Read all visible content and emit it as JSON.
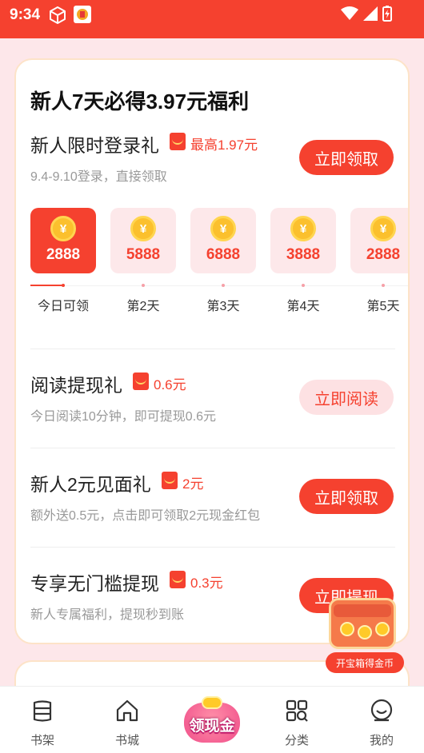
{
  "status_bar": {
    "time": "9:34"
  },
  "card": {
    "title": "新人7天必得3.97元福利",
    "login": {
      "title": "新人限时登录礼",
      "reward": "最高1.97元",
      "sub": "9.4-9.10登录，直接领取",
      "button": "立即领取"
    },
    "days": [
      {
        "amount": "2888",
        "label": "今日可领",
        "active": true
      },
      {
        "amount": "5888",
        "label": "第2天",
        "active": false
      },
      {
        "amount": "6888",
        "label": "第3天",
        "active": false
      },
      {
        "amount": "3888",
        "label": "第4天",
        "active": false
      },
      {
        "amount": "2888",
        "label": "第5天",
        "active": false
      }
    ],
    "coin_symbol": "¥",
    "read": {
      "title": "阅读提现礼",
      "reward": "0.6元",
      "sub": "今日阅读10分钟，即可提现0.6元",
      "button": "立即阅读"
    },
    "gift": {
      "title": "新人2元见面礼",
      "reward": "2元",
      "sub": "额外送0.5元，点击即可领取2元现金红包",
      "button": "立即领取"
    },
    "withdraw": {
      "title": "专享无门槛提现",
      "reward": "0.3元",
      "sub": "新人专属福利，提现秒到账",
      "button": "立即提现"
    }
  },
  "chest": {
    "label": "开宝箱得金币"
  },
  "tabbar": {
    "bookshelf": "书架",
    "bookcity": "书城",
    "center": "领现金",
    "category": "分类",
    "mine": "我的"
  },
  "colors": {
    "accent": "#f5412f",
    "background": "#fde7ea",
    "soft_button": "#fde1e3"
  }
}
